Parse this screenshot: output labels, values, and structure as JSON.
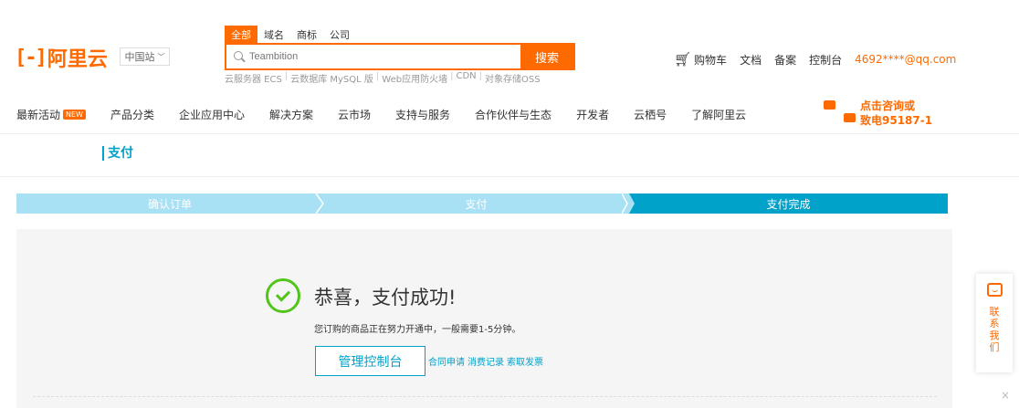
{
  "header": {
    "logo_mark": "[-]",
    "logo_text": "阿里云",
    "region": "中国站",
    "search_tabs": [
      "全部",
      "域名",
      "商标",
      "公司"
    ],
    "search_placeholder": "Teambition",
    "search_button": "搜索",
    "hot_words": [
      "云服务器 ECS",
      "云数据库 MySQL 版",
      "Web应用防火墙",
      "CDN",
      "对象存储OSS"
    ],
    "cart": "购物车",
    "docs": "文档",
    "beian": "备案",
    "console": "控制台",
    "email": "4692****@qq.com"
  },
  "nav": {
    "items": [
      "最新活动",
      "产品分类",
      "企业应用中心",
      "解决方案",
      "云市场",
      "支持与服务",
      "合作伙伴与生态",
      "开发者",
      "云栖号",
      "了解阿里云"
    ],
    "new_badge": "NEW",
    "consult_line1": "点击咨询或",
    "consult_line2": "致电95187-1"
  },
  "page": {
    "title": "支付"
  },
  "steps": [
    "确认订单",
    "支付",
    "支付完成"
  ],
  "success": {
    "title": "恭喜，支付成功!",
    "desc": "您订购的商品正在努力开通中，一般需要1-5分钟。",
    "console_button": "管理控制台",
    "links": [
      "合同申请",
      "消费记录",
      "索取发票"
    ]
  },
  "contact": {
    "label": "联系我们",
    "close": "×"
  },
  "colors": {
    "brand": "#ff6a00",
    "accent": "#00a2ca",
    "success": "#52c41a"
  }
}
